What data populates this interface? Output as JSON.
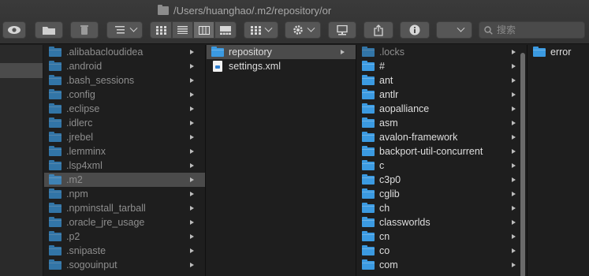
{
  "window": {
    "path": "/Users/huanghao/.m2/repository/or"
  },
  "toolbar": {
    "search_placeholder": "搜索"
  },
  "columns": {
    "col1": [
      {
        "label": ".alibabacloudidea",
        "dim": true
      },
      {
        "label": ".android",
        "dim": true
      },
      {
        "label": ".bash_sessions",
        "dim": true
      },
      {
        "label": ".config",
        "dim": true
      },
      {
        "label": ".eclipse",
        "dim": true
      },
      {
        "label": ".idlerc",
        "dim": true
      },
      {
        "label": ".jrebel",
        "dim": true
      },
      {
        "label": ".lemminx",
        "dim": true
      },
      {
        "label": ".lsp4xml",
        "dim": true
      },
      {
        "label": ".m2",
        "dim": true,
        "selected": true
      },
      {
        "label": ".npm",
        "dim": true
      },
      {
        "label": ".npminstall_tarball",
        "dim": true
      },
      {
        "label": ".oracle_jre_usage",
        "dim": true
      },
      {
        "label": ".p2",
        "dim": true
      },
      {
        "label": ".snipaste",
        "dim": true
      },
      {
        "label": ".sogouinput",
        "dim": true
      }
    ],
    "col2": [
      {
        "label": "repository",
        "type": "folder",
        "selected": true
      },
      {
        "label": "settings.xml",
        "type": "file"
      }
    ],
    "col3": [
      {
        "label": ".locks",
        "dim": true
      },
      {
        "label": "#"
      },
      {
        "label": "ant"
      },
      {
        "label": "antlr"
      },
      {
        "label": "aopalliance"
      },
      {
        "label": "asm"
      },
      {
        "label": "avalon-framework"
      },
      {
        "label": "backport-util-concurrent"
      },
      {
        "label": "c"
      },
      {
        "label": "c3p0"
      },
      {
        "label": "cglib"
      },
      {
        "label": "ch"
      },
      {
        "label": "classworlds"
      },
      {
        "label": "cn"
      },
      {
        "label": "co"
      },
      {
        "label": "com"
      }
    ],
    "col4": [
      {
        "label": "error"
      }
    ]
  }
}
